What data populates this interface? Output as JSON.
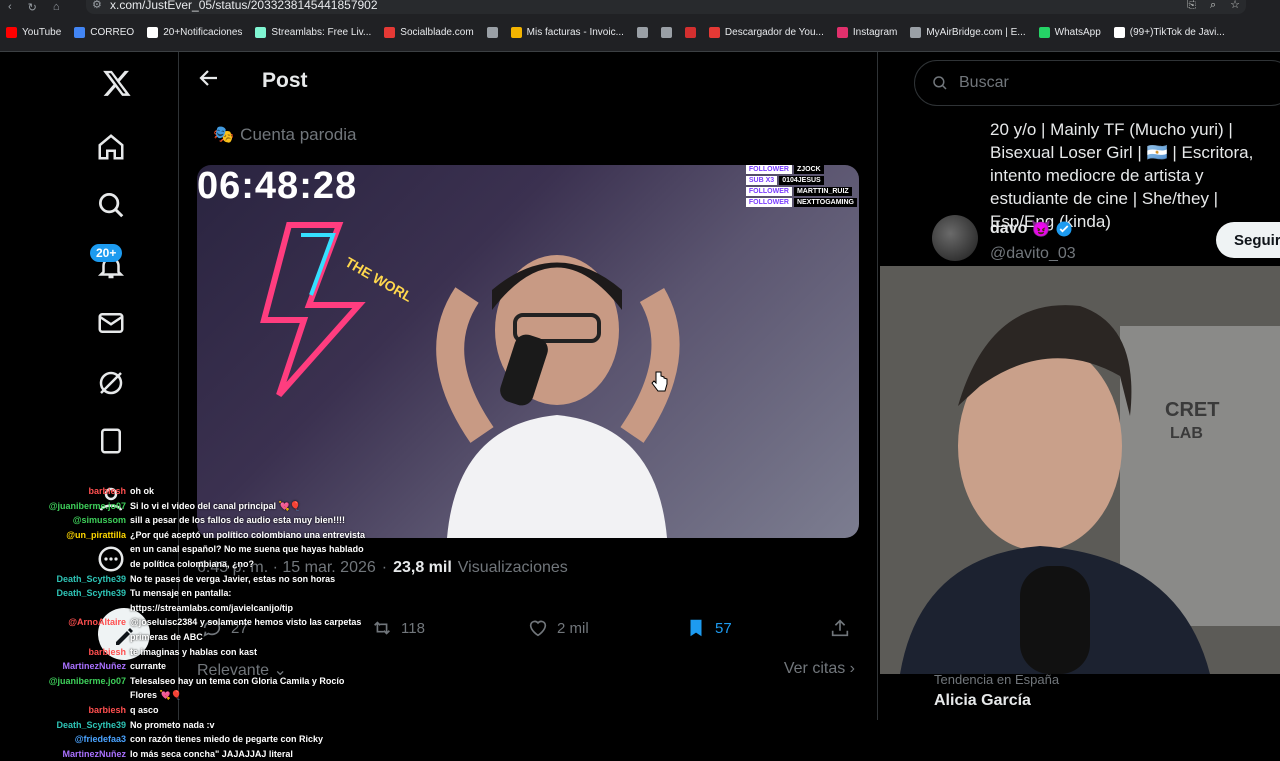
{
  "browser": {
    "url": "x.com/JustEver_05/status/2033238145441857902"
  },
  "bookmarks": [
    {
      "label": "YouTube",
      "color": "#ff0000"
    },
    {
      "label": "CORREO",
      "color": "#4285f4"
    },
    {
      "label": "20+Notificaciones",
      "color": "#ffffff"
    },
    {
      "label": "Streamlabs: Free Liv...",
      "color": "#80f5d2"
    },
    {
      "label": "Socialblade.com",
      "color": "#e53935"
    },
    {
      "label": "",
      "color": "#9aa0a6"
    },
    {
      "label": "Mis facturas - Invoic...",
      "color": "#f4b400"
    },
    {
      "label": "",
      "color": "#9aa0a6"
    },
    {
      "label": "",
      "color": "#9aa0a6"
    },
    {
      "label": "",
      "color": "#d32f2f"
    },
    {
      "label": "Descargador de You...",
      "color": "#e53935"
    },
    {
      "label": "Instagram",
      "color": "#e1306c"
    },
    {
      "label": "MyAirBridge.com | E...",
      "color": "#9aa0a6"
    },
    {
      "label": "WhatsApp",
      "color": "#25d366"
    },
    {
      "label": "(99+)TikTok de Javi...",
      "color": "#ffffff"
    }
  ],
  "nav": {
    "notifications_badge": "20+"
  },
  "post": {
    "header_title": "Post",
    "parody_label": "Cuenta parodia",
    "video_timer": "06:48:28",
    "stream_tags": [
      {
        "kind": "FOLLOWER",
        "name": "ZJOCK"
      },
      {
        "kind": "SUB X3",
        "name": "0104JESUS"
      },
      {
        "kind": "FOLLOWER",
        "name": "MARTTIN_RUIZ"
      },
      {
        "kind": "FOLLOWER",
        "name": "NEXTTOGAMING"
      }
    ],
    "date": "6:45 p. m. · 15 mar. 2026",
    "views_count": "23,8 mil",
    "views_label": "Visualizaciones",
    "replies": "27",
    "reposts": "118",
    "likes": "2 mil",
    "bookmarks": "57",
    "sort_label": "Relevante",
    "quotes_label": "Ver citas"
  },
  "sidebar": {
    "search_placeholder": "Buscar",
    "bio": "20 y/o | Mainly TF (Mucho yuri) | Bisexual Loser Girl | 🇦🇷 | Escritora, intento mediocre de artista y estudiante de cine | She/they | Esp/Eng (kinda)",
    "user_name": "davo",
    "user_handle": "@davito_03",
    "follow_label": "Seguir",
    "trend_context": "Tendencia en España",
    "trend_name": "Alicia García"
  },
  "chat": [
    {
      "user": "barbiesh",
      "color": "#ff4f4f",
      "msg": "oh ok"
    },
    {
      "user": "@juaniberme.jo07",
      "color": "#3ecf5a",
      "msg": "Si lo vi el video del canal principal 💘🎈"
    },
    {
      "user": "@simussom",
      "color": "#3ecf5a",
      "msg": "sill a pesar de los fallos de audio esta muy bien!!!!"
    },
    {
      "user": "@un_pirattilla",
      "color": "#ffd700",
      "msg": "¿Por qué aceptó un político colombiano una entrevista en un canal español? No me suena que hayas hablado de política colombiana, ¿no?"
    },
    {
      "user": "Death_Scythe39",
      "color": "#2ec4b6",
      "msg": "No te pases de verga Javier, estas no son horas"
    },
    {
      "user": "Death_Scythe39",
      "color": "#2ec4b6",
      "msg": "Tu mensaje en pantalla: https://streamlabs.com/javielcanijo/tip"
    },
    {
      "user": "@ArnoAltaire",
      "color": "#ff4f4f",
      "msg": "@joseluisc2384 y solamente hemos visto las carpetas primeras de ABC"
    },
    {
      "user": "barbiesh",
      "color": "#ff4f4f",
      "msg": "te imaginas y hablas con kast"
    },
    {
      "user": "MartinezNuñez",
      "color": "#a970ff",
      "msg": "currante"
    },
    {
      "user": "@juaniberme.jo07",
      "color": "#3ecf5a",
      "msg": "Telesalseo hay un tema con Gloria Camila y Rocío Flores 💘🎈"
    },
    {
      "user": "barbiesh",
      "color": "#ff4f4f",
      "msg": "q asco"
    },
    {
      "user": "Death_Scythe39",
      "color": "#2ec4b6",
      "msg": "No prometo nada :v"
    },
    {
      "user": "@friedefaa3",
      "color": "#4aa3ff",
      "msg": "con razón tienes miedo de pegarte con Ricky"
    },
    {
      "user": "MartinezNuñez",
      "color": "#a970ff",
      "msg": "lo más seca concha\" JAJAJJAJ literal"
    }
  ]
}
